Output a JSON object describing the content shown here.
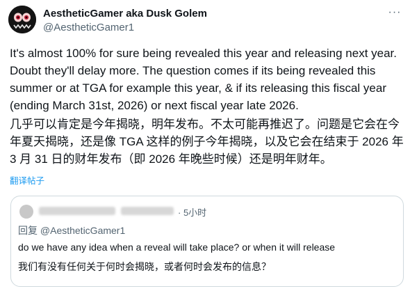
{
  "tweet": {
    "author_name": "AestheticGamer aka Dusk Golem",
    "author_handle": "@AestheticGamer1",
    "more_icon": "more-horizontal-icon",
    "text_en": "It's almost 100% for sure being revealed this year and releasing next year. Doubt they'll delay more. The question comes if its being revealed this summer or at TGA for example this year, & if its releasing this fiscal year (ending March 31st, 2026) or next fiscal year late 2026.",
    "text_zh": "几乎可以肯定是今年揭晓，明年发布。不太可能再推迟了。问题是它会在今年夏天揭晓，还是像 TGA 这样的例子今年揭晓，以及它会在结束于 2026 年 3 月 31 日的财年发布（即 2026 年晚些时候）还是明年财年。",
    "translate_label": "翻译帖子"
  },
  "quoted": {
    "time": "· 5小时",
    "reply_to": "回复 @AestheticGamer1",
    "text_en": "do we have any idea when a reveal will take place? or when it will release",
    "text_zh": "我们有没有任何关于何时会揭晓，或者何时会发布的信息？"
  },
  "colors": {
    "link": "#1d9bf0",
    "secondary_text": "#536471",
    "border": "#cfd9de"
  }
}
